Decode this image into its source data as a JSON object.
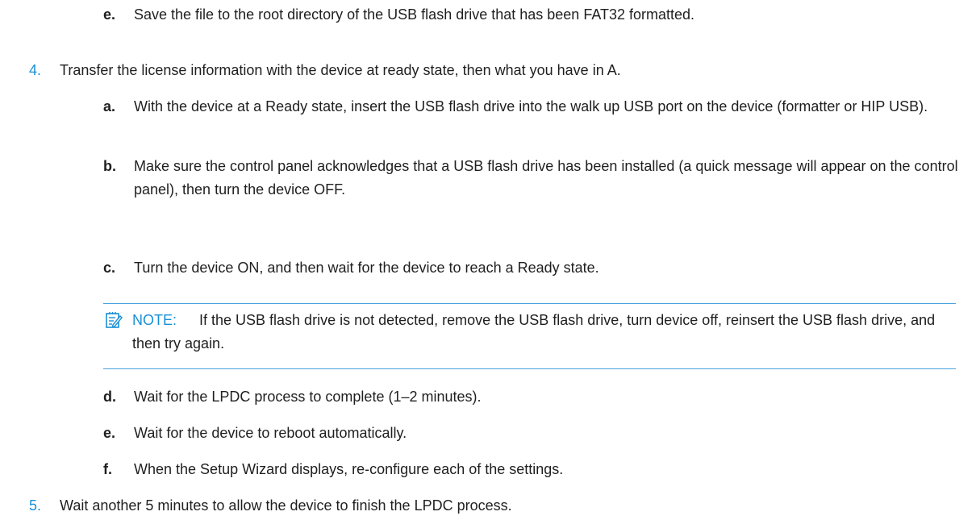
{
  "steps": [
    {
      "marker": "e.",
      "text": "Save the file to the root directory of the USB flash drive that has been FAT32 formatted."
    },
    {
      "marker": "4.",
      "text": "Transfer the license information with the device at ready state, then what you have in A."
    },
    {
      "marker": "a.",
      "text": "With the device at a Ready state, insert the USB flash drive into the walk up USB port on the device (formatter or HIP USB)."
    },
    {
      "marker": "b.",
      "text": "Make sure the control panel acknowledges that a USB flash drive has been installed (a quick message will appear on the control panel), then turn the device OFF."
    },
    {
      "marker": "c.",
      "text": "Turn the device ON, and then wait for the device to reach a Ready state."
    },
    {
      "marker": "d.",
      "text": "Wait for the LPDC process to complete (1–2 minutes)."
    },
    {
      "marker": "e.",
      "text": "Wait for the device to reboot automatically."
    },
    {
      "marker": "f.",
      "text": "When the Setup Wizard displays, re-configure each of the settings."
    },
    {
      "marker": "5.",
      "text": "Wait another 5 minutes to allow the device to finish the LPDC process."
    }
  ],
  "note": {
    "icon": "note-icon",
    "label": "NOTE:",
    "text": "If the USB flash drive is not detected, remove the USB flash drive, turn device off, reinsert the USB flash drive, and then try again."
  },
  "colors": {
    "accent": "#1a8fd6",
    "rule": "#4aa3df",
    "text": "#1f1f1f"
  }
}
